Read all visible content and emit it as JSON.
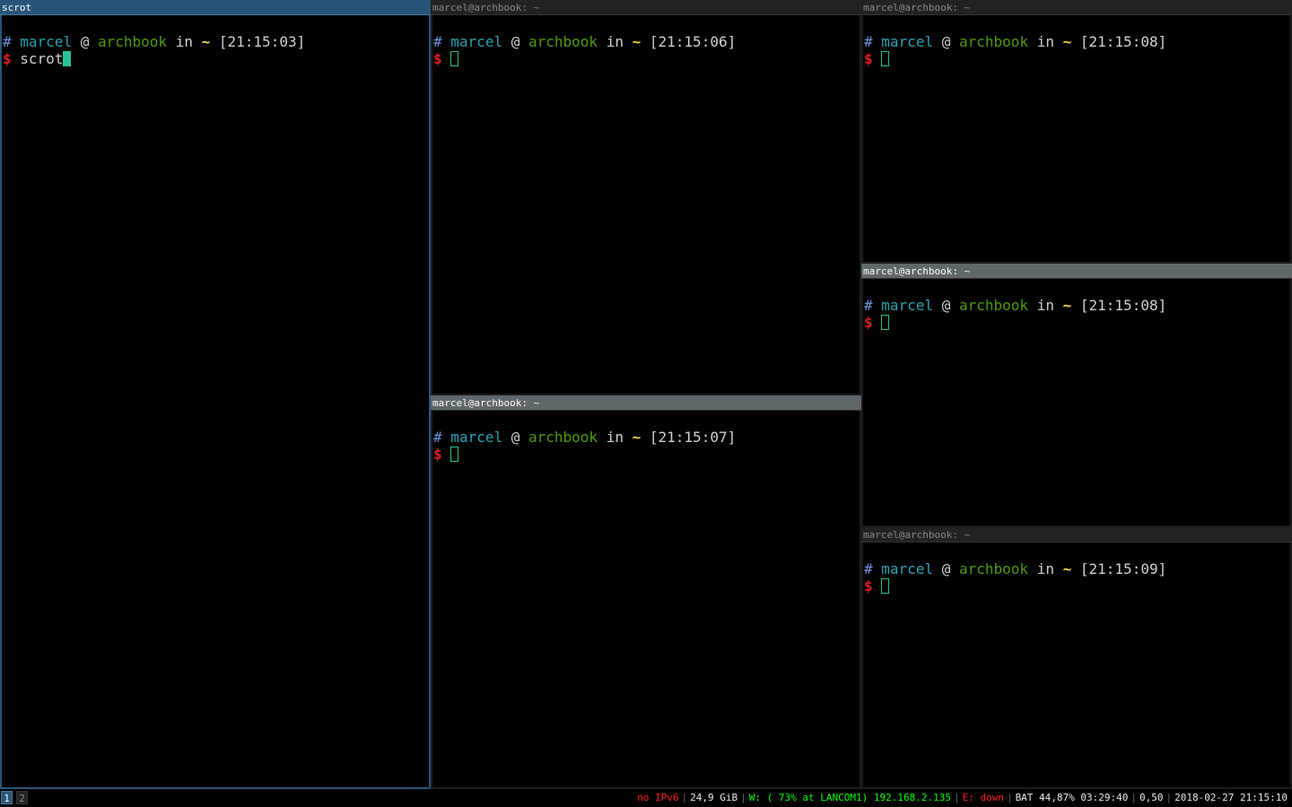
{
  "windows": {
    "w1": {
      "title": "scrot",
      "prompt": {
        "hash": "#",
        "user": "marcel",
        "at": "@",
        "host": "archbook",
        "in": "in",
        "dir": "~",
        "time": "[21:15:03]",
        "dollar": "$",
        "command": "scrot"
      }
    },
    "w2": {
      "title": "marcel@archbook: ~",
      "prompt": {
        "hash": "#",
        "user": "marcel",
        "at": "@",
        "host": "archbook",
        "in": "in",
        "dir": "~",
        "time": "[21:15:06]",
        "dollar": "$",
        "command": ""
      }
    },
    "w3": {
      "title": "marcel@archbook: ~",
      "prompt": {
        "hash": "#",
        "user": "marcel",
        "at": "@",
        "host": "archbook",
        "in": "in",
        "dir": "~",
        "time": "[21:15:07]",
        "dollar": "$",
        "command": ""
      }
    },
    "w4": {
      "title": "marcel@archbook: ~",
      "prompt": {
        "hash": "#",
        "user": "marcel",
        "at": "@",
        "host": "archbook",
        "in": "in",
        "dir": "~",
        "time": "[21:15:08]",
        "dollar": "$",
        "command": ""
      }
    },
    "w5": {
      "title": "marcel@archbook: ~",
      "prompt": {
        "hash": "#",
        "user": "marcel",
        "at": "@",
        "host": "archbook",
        "in": "in",
        "dir": "~",
        "time": "[21:15:08]",
        "dollar": "$",
        "command": ""
      }
    },
    "w6": {
      "title": "marcel@archbook: ~",
      "prompt": {
        "hash": "#",
        "user": "marcel",
        "at": "@",
        "host": "archbook",
        "in": "in",
        "dir": "~",
        "time": "[21:15:09]",
        "dollar": "$",
        "command": ""
      }
    }
  },
  "bar": {
    "workspaces": [
      "1",
      "2"
    ],
    "status": {
      "ipv6": "no IPv6",
      "disk": "24,9 GiB",
      "wifi": "W: ( 73% at LANCOM1) 192.168.2.135",
      "ethernet": "E: down",
      "battery": "BAT 44,87% 03:29:40",
      "load": "0,50",
      "datetime": "2018-02-27 21:15:10"
    }
  },
  "colors": {
    "focused_title": "#285577",
    "focused_inactive_title": "#5f676a",
    "unfocused_title": "#222222",
    "cursor": "#26c296",
    "prompt_user": "#2aa1b3",
    "prompt_host": "#4e9a06",
    "prompt_dollar": "#e01b24",
    "status_bad": "#ff2020",
    "status_good": "#00ff00"
  }
}
